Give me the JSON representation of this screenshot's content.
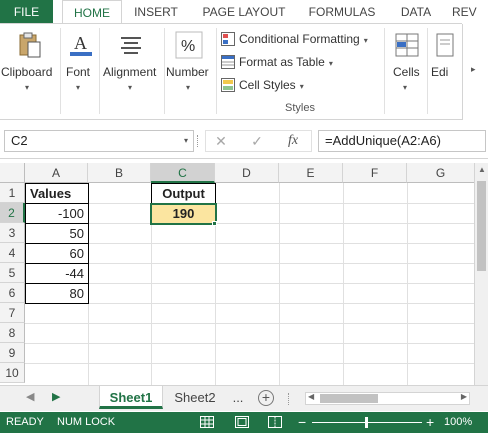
{
  "ribbon_tabs": [
    "FILE",
    "HOME",
    "INSERT",
    "PAGE LAYOUT",
    "FORMULAS",
    "DATA",
    "REV"
  ],
  "ribbon_groups": {
    "clipboard": "Clipboard",
    "font": "Font",
    "alignment": "Alignment",
    "number": "Number",
    "cells": "Cells",
    "editing": "Edi"
  },
  "styles_group": {
    "conditional_formatting": "Conditional Formatting",
    "format_as_table": "Format as Table",
    "cell_styles": "Cell Styles",
    "label": "Styles"
  },
  "formula_bar": {
    "name_box": "C2",
    "cancel_symbol": "✕",
    "enter_symbol": "✓",
    "fx_symbol": "fx",
    "formula": "=AddUnique(A2:A6)"
  },
  "grid": {
    "columns": [
      "A",
      "B",
      "C",
      "D",
      "E",
      "F",
      "G"
    ],
    "rows": [
      "1",
      "2",
      "3",
      "4",
      "5",
      "6",
      "7",
      "8",
      "9",
      "10"
    ],
    "selected_column": "C",
    "selected_row": "2",
    "values_header": "Values",
    "values": [
      "-100",
      "50",
      "60",
      "-44",
      "80"
    ],
    "output_header": "Output",
    "output_value": "190"
  },
  "sheets": {
    "tabs": [
      "Sheet1",
      "Sheet2"
    ],
    "active": "Sheet1",
    "more": "...",
    "add_symbol": "+"
  },
  "status_bar": {
    "ready": "READY",
    "num_lock": "NUM LOCK",
    "zoom": "100%"
  },
  "colors": {
    "accent": "#217346",
    "output_fill": "#fbe5a0"
  }
}
